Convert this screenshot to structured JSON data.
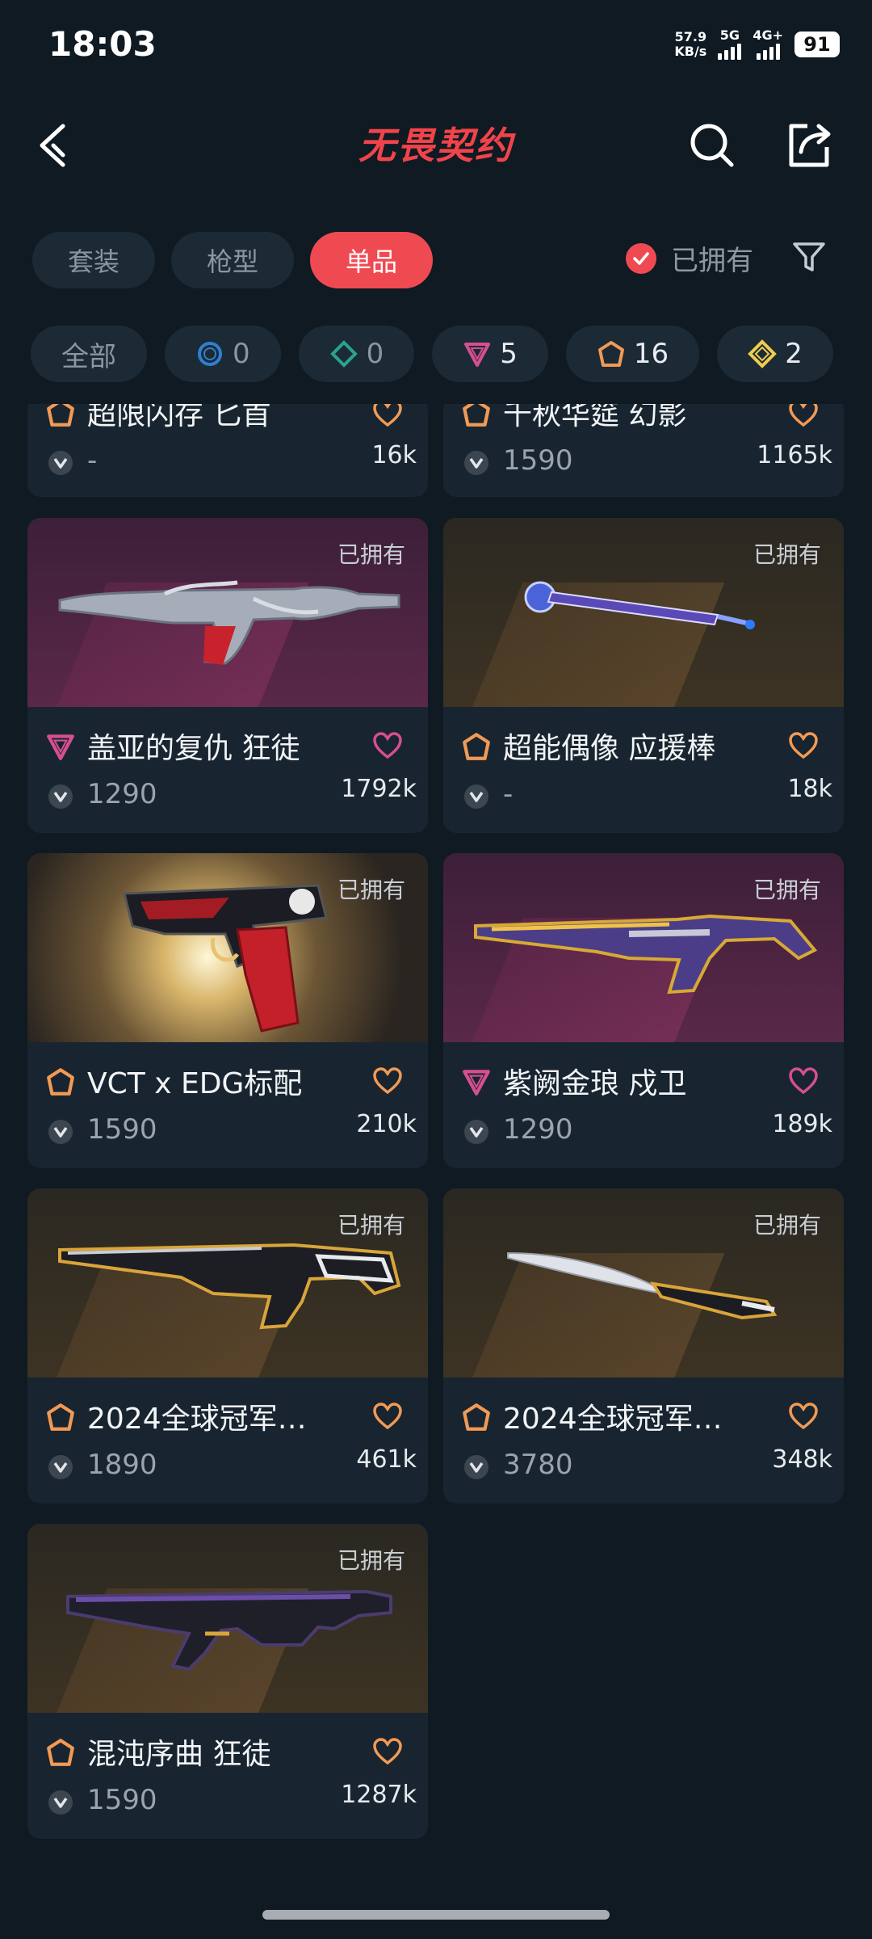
{
  "status_bar": {
    "time": "18:03",
    "net_speed_value": "57.9",
    "net_speed_unit": "KB/s",
    "signal1_label": "5G",
    "signal2_label": "4G+",
    "battery": "91"
  },
  "header": {
    "logo_text": "无畏契约"
  },
  "tabs": [
    {
      "label": "套装",
      "active": false
    },
    {
      "label": "枪型",
      "active": false
    },
    {
      "label": "单品",
      "active": true
    }
  ],
  "owned_filter": {
    "label": "已拥有",
    "checked": true
  },
  "rarity_filters": [
    {
      "label": "全部"
    },
    {
      "count": "0",
      "icon": "select-tier-icon",
      "color": "#2f7fd0"
    },
    {
      "count": "0",
      "icon": "deluxe-tier-icon",
      "color": "#2aa38c"
    },
    {
      "count": "5",
      "icon": "premium-tier-icon",
      "color": "#d64f8e"
    },
    {
      "count": "16",
      "icon": "exclusive-tier-icon",
      "color": "#f29a55"
    },
    {
      "count": "2",
      "icon": "ultra-tier-icon",
      "color": "#f1cc4e"
    }
  ],
  "partial_items": [
    {
      "name": "超限闪存 匕首",
      "price": "-",
      "likes": "16k"
    },
    {
      "name": "千秋华筵 幻影",
      "price": "1590",
      "likes": "1165k"
    }
  ],
  "items": [
    {
      "name": "盖亚的复仇 狂徒",
      "price": "1290",
      "likes": "1792k",
      "owned_label": "已拥有",
      "tier": "premium",
      "bg": "purple"
    },
    {
      "name": "超能偶像 应援棒",
      "price": "-",
      "likes": "18k",
      "owned_label": "已拥有",
      "tier": "exclusive",
      "bg": "gold"
    },
    {
      "name": "VCT x EDG标配",
      "price": "1590",
      "likes": "210k",
      "owned_label": "已拥有",
      "tier": "exclusive",
      "bg": "edg"
    },
    {
      "name": "紫阙金琅 戍卫",
      "price": "1290",
      "likes": "189k",
      "owned_label": "已拥有",
      "tier": "premium",
      "bg": "purple"
    },
    {
      "name": "2024全球冠军…",
      "price": "1890",
      "likes": "461k",
      "owned_label": "已拥有",
      "tier": "exclusive",
      "bg": "gold"
    },
    {
      "name": "2024全球冠军…",
      "price": "3780",
      "likes": "348k",
      "owned_label": "已拥有",
      "tier": "exclusive",
      "bg": "gold"
    },
    {
      "name": "混沌序曲 狂徒",
      "price": "1590",
      "likes": "1287k",
      "owned_label": "已拥有",
      "tier": "exclusive",
      "bg": "gold"
    }
  ],
  "colors": {
    "accent": "#ef4a52",
    "background": "#0f1a23",
    "card": "#182530",
    "premium": "#d64f8e",
    "exclusive": "#f29a55"
  }
}
